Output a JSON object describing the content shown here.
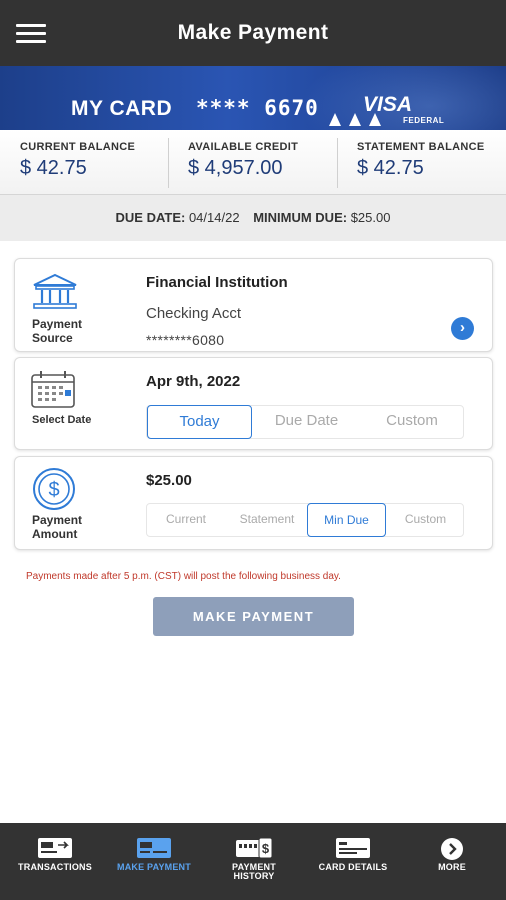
{
  "header": {
    "title": "Make Payment",
    "menu_icon": "hamburger-menu-icon"
  },
  "card_banner": {
    "label": "MY CARD",
    "masked_number": "**** 6670",
    "brand": "VISA",
    "brand_sub": "FEDERAL"
  },
  "balances": [
    {
      "label": "CURRENT BALANCE",
      "value": "$ 42.75"
    },
    {
      "label": "AVAILABLE CREDIT",
      "value": "$ 4,957.00"
    },
    {
      "label": "STATEMENT BALANCE",
      "value": "$ 42.75"
    }
  ],
  "due": {
    "due_label": "DUE DATE:",
    "due_value": "04/14/22",
    "min_label": "MINIMUM DUE:",
    "min_value": "$25.00"
  },
  "payment_source": {
    "icon": "bank-icon",
    "label": "Payment Source",
    "title": "Financial Institution",
    "account_type": "Checking Acct",
    "account_number": "********6080"
  },
  "select_date": {
    "icon": "calendar-icon",
    "label": "Select Date",
    "value": "Apr 9th, 2022",
    "options": [
      "Today",
      "Due Date",
      "Custom"
    ],
    "selected": "Today"
  },
  "payment_amount": {
    "icon": "dollar-coin-icon",
    "label": "Payment Amount",
    "value": "$25.00",
    "options": [
      "Current",
      "Statement",
      "Min Due",
      "Custom"
    ],
    "selected": "Min Due"
  },
  "notice": "Payments made after 5 p.m. (CST) will post the following business day.",
  "submit_label": "MAKE PAYMENT",
  "bottom_nav": [
    {
      "label": "TRANSACTIONS",
      "icon": "transactions-icon",
      "active": false
    },
    {
      "label": "MAKE PAYMENT",
      "icon": "make-payment-icon",
      "active": true
    },
    {
      "label": "PAYMENT HISTORY",
      "icon": "payment-history-icon",
      "active": false
    },
    {
      "label": "CARD DETAILS",
      "icon": "card-details-icon",
      "active": false
    },
    {
      "label": "MORE",
      "icon": "more-chevron-icon",
      "active": false
    }
  ],
  "colors": {
    "accent": "#2f7bd6",
    "header_bg": "#333333",
    "balance_value": "#1f3c78",
    "notice": "#c0392b",
    "button": "#8e9fba"
  }
}
